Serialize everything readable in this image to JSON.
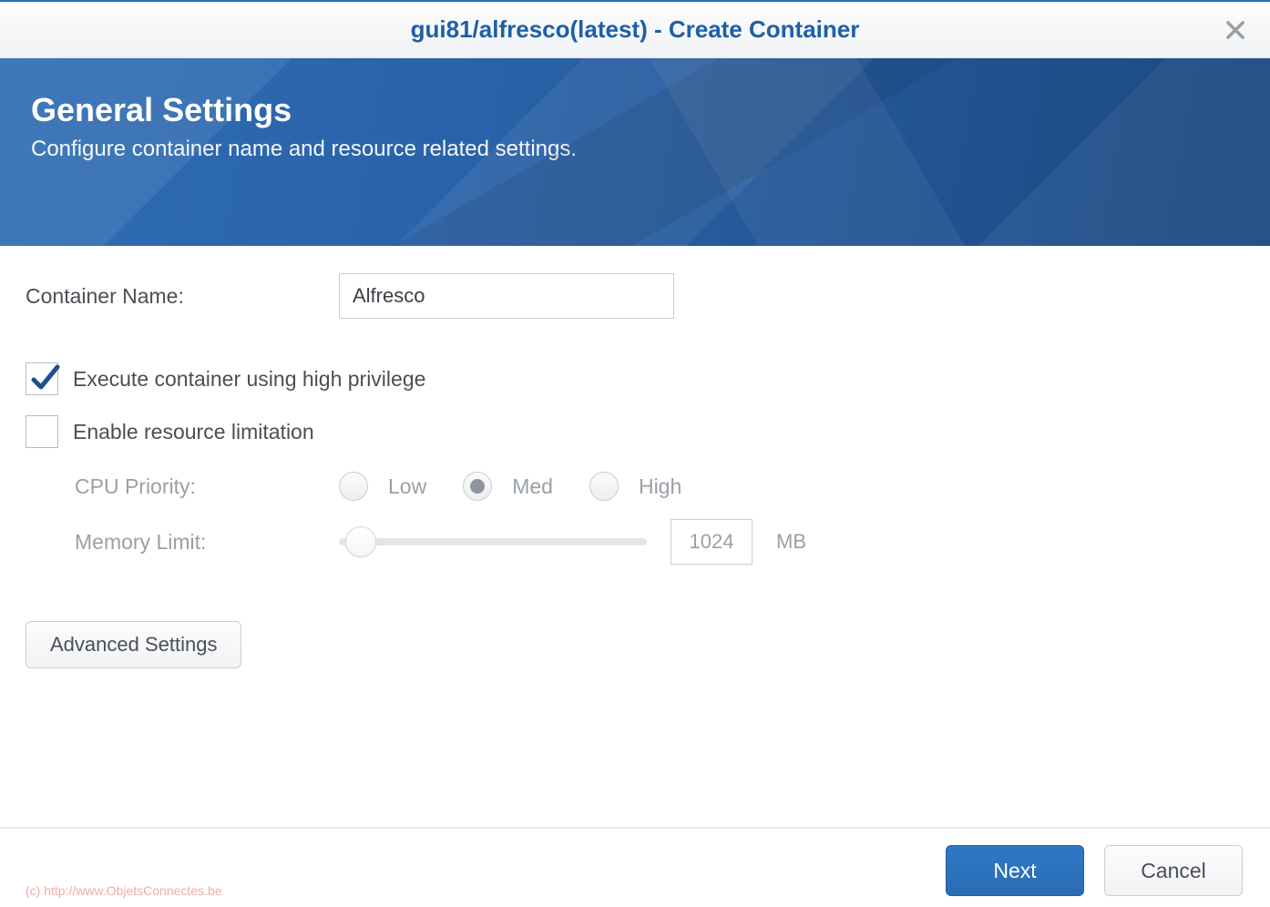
{
  "title": "gui81/alfresco(latest) - Create Container",
  "banner": {
    "heading": "General Settings",
    "subheading": "Configure container name and resource related settings."
  },
  "form": {
    "container_name_label": "Container Name:",
    "container_name_value": "Alfresco",
    "high_privilege_label": "Execute container using high privilege",
    "high_privilege_checked": true,
    "resource_limit_label": "Enable resource limitation",
    "resource_limit_checked": false,
    "cpu_priority_label": "CPU Priority:",
    "cpu_options": {
      "low": "Low",
      "med": "Med",
      "high": "High"
    },
    "cpu_selected": "med",
    "memory_limit_label": "Memory Limit:",
    "memory_value": "1024",
    "memory_unit": "MB",
    "advanced_label": "Advanced Settings"
  },
  "footer": {
    "next": "Next",
    "cancel": "Cancel",
    "watermark": "(c) http://www.ObjetsConnectes.be"
  }
}
